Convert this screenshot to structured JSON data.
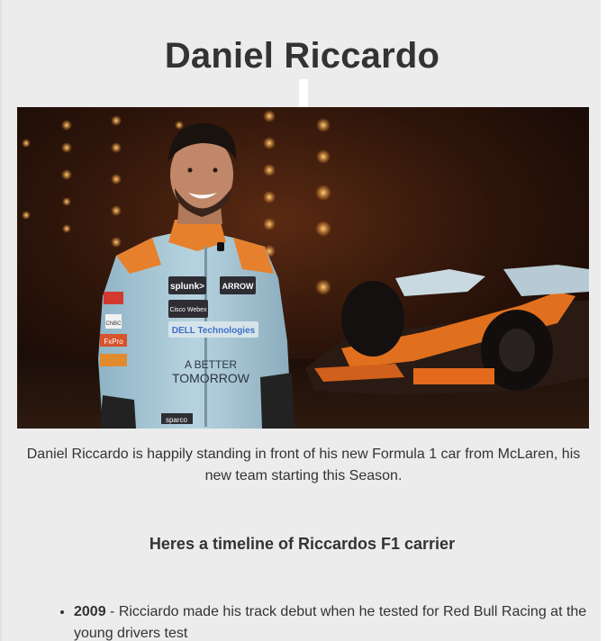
{
  "page": {
    "title": "Daniel Riccardo",
    "caption": "Daniel Riccardo is happily standing in front of his new Formula 1 car from McLaren, his new team starting this Season.",
    "timeline_heading": "Heres a timeline of Riccardos F1 carrier"
  },
  "photo": {
    "alt": "Daniel Riccardo in a light-blue McLaren race suit standing in front of an orange and blue Formula 1 car",
    "suit_logos": [
      "splunk>",
      "ARROW",
      "Cisco Webex",
      "DELL Technologies",
      "A BETTER TOMORROW",
      "sparco",
      "CNBC",
      "FxPro"
    ]
  },
  "timeline": [
    {
      "year": "2009",
      "text": " - Ricciardo made his track debut when he tested for Red Bull Racing at the young drivers test"
    }
  ]
}
